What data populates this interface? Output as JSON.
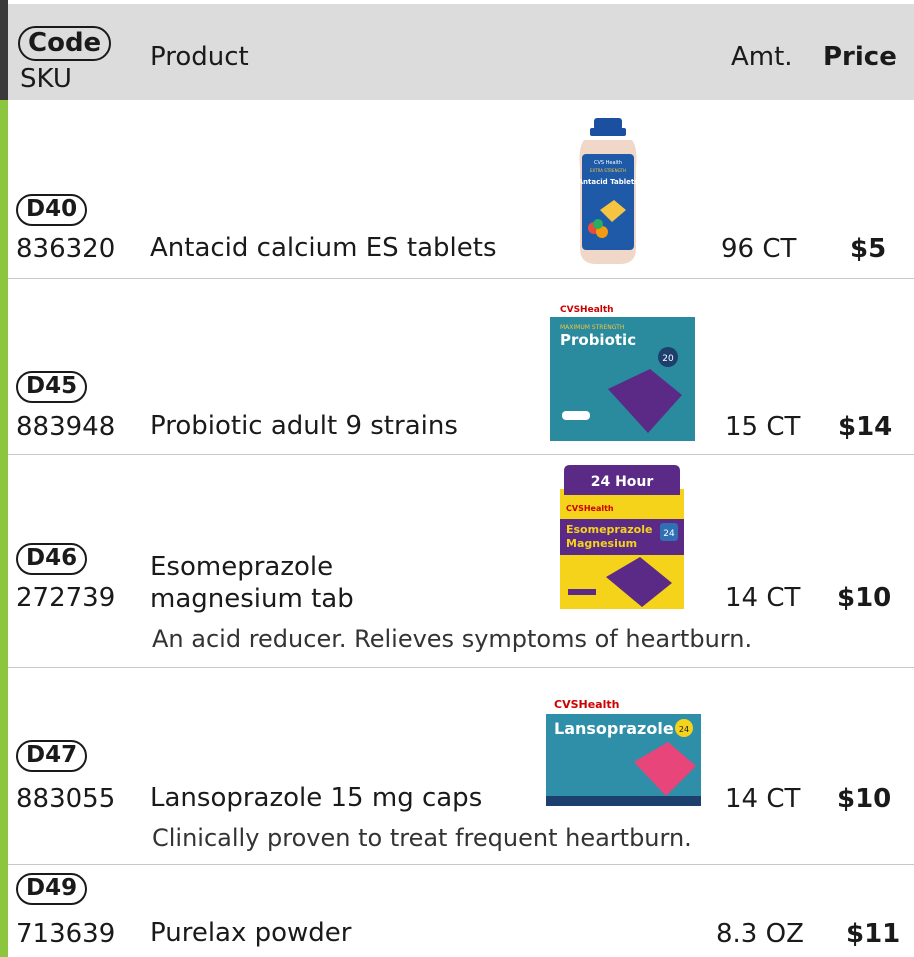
{
  "header": {
    "code_label": "Code",
    "sku_label": "SKU",
    "product_label": "Product",
    "amt_label": "Amt.",
    "price_label": "Price"
  },
  "colors": {
    "accent_bar": "#8cc63e",
    "header_bg": "#dcdcdc",
    "header_bar": "#3a3a3a"
  },
  "items": [
    {
      "code": "D40",
      "sku": "836320",
      "name": "Antacid calcium ES tablets",
      "amount": "96 CT",
      "price": "$5",
      "package": {
        "brand": "CVS Health",
        "line1": "EXTRA STRENGTH",
        "title": "Antacid Tablets"
      }
    },
    {
      "code": "D45",
      "sku": "883948",
      "name": "Probiotic adult 9 strains",
      "amount": "15 CT",
      "price": "$14",
      "package": {
        "brand": "CVSHealth",
        "line1": "MAXIMUM STRENGTH",
        "title": "Probiotic",
        "badge": "20"
      }
    },
    {
      "code": "D46",
      "sku": "272739",
      "name_line1": "Esomeprazole",
      "name_line2": "magnesium tab",
      "amount": "14 CT",
      "price": "$10",
      "description": "An acid reducer. Relieves symptoms of heartburn.",
      "package": {
        "banner": "24 Hour",
        "brand": "CVSHealth",
        "title1": "Esomeprazole",
        "title2": "Magnesium",
        "badge": "24"
      }
    },
    {
      "code": "D47",
      "sku": "883055",
      "name": "Lansoprazole 15 mg caps",
      "amount": "14 CT",
      "price": "$10",
      "description": "Clinically proven to treat frequent heartburn.",
      "package": {
        "brand": "CVSHealth",
        "title": "Lansoprazole",
        "badge": "24"
      }
    },
    {
      "code": "D49",
      "sku": "713639",
      "name": "Purelax powder",
      "amount": "8.3 OZ",
      "price": "$11"
    }
  ]
}
